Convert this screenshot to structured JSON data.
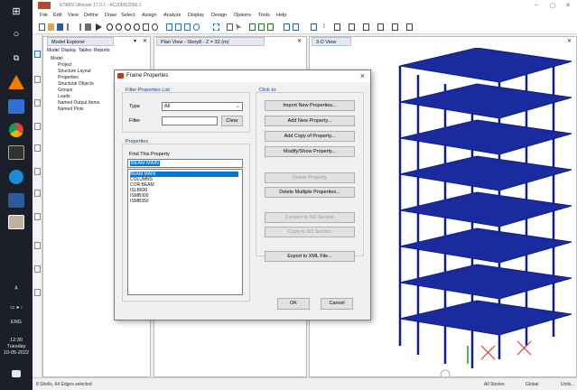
{
  "taskbar": {
    "time": "12:30",
    "day": "Tuesday",
    "date": "10-05-2022",
    "lang": "ENG"
  },
  "app": {
    "title": "ETABS Ultimate 17.0.1 - AC20MS2006.1",
    "menus": [
      "File",
      "Edit",
      "View",
      "Define",
      "Draw",
      "Select",
      "Assign",
      "Analyze",
      "Display",
      "Design",
      "Options",
      "Tools",
      "Help"
    ],
    "win_controls": [
      "–",
      "▢",
      "✕"
    ]
  },
  "explorer": {
    "tab": "Model Explorer",
    "subtabs": [
      "Model",
      "Display",
      "Tables",
      "Reports"
    ],
    "tree": [
      "Model",
      "Project",
      "Structure Layout",
      "Properties",
      "Structural Objects",
      "Groups",
      "Loads",
      "Named Output Items",
      "Named Plots"
    ]
  },
  "planview": {
    "tab": "Plan View - Story8 - Z = 32 (m)"
  },
  "view3d": {
    "tab": "3-D View"
  },
  "status": {
    "left": "8 Shells, 64 Edges selected",
    "stories": "All Stories",
    "global": "Global",
    "units": "Units..."
  },
  "dialog": {
    "title": "Frame Properties",
    "filter_group": "Filter Properties List",
    "type_label": "Type",
    "type_value": "All",
    "filter_label": "Filter",
    "filter_value": "",
    "clear": "Clear",
    "properties_group": "Properties",
    "find_label": "Find This Property",
    "find_value": "BEAM MAIN",
    "items": [
      "BEAM MAIN",
      "COLUMNS",
      "COR BEAM",
      "ISLB600",
      "ISMB300",
      "ISMB350"
    ],
    "selected_index": 0,
    "click_to": "Click to:",
    "buttons": {
      "import": "Import New Properties...",
      "add": "Add New Property...",
      "add_copy": "Add Copy of Property...",
      "modify": "Modify/Show Property...",
      "delete": "Delete Property",
      "delete_multiple": "Delete Multiple Properties...",
      "convert": "Convert to SD Section",
      "copy_sd": "Copy to SD Section",
      "export": "Export to XML File...",
      "ok": "OK",
      "cancel": "Cancel"
    }
  }
}
